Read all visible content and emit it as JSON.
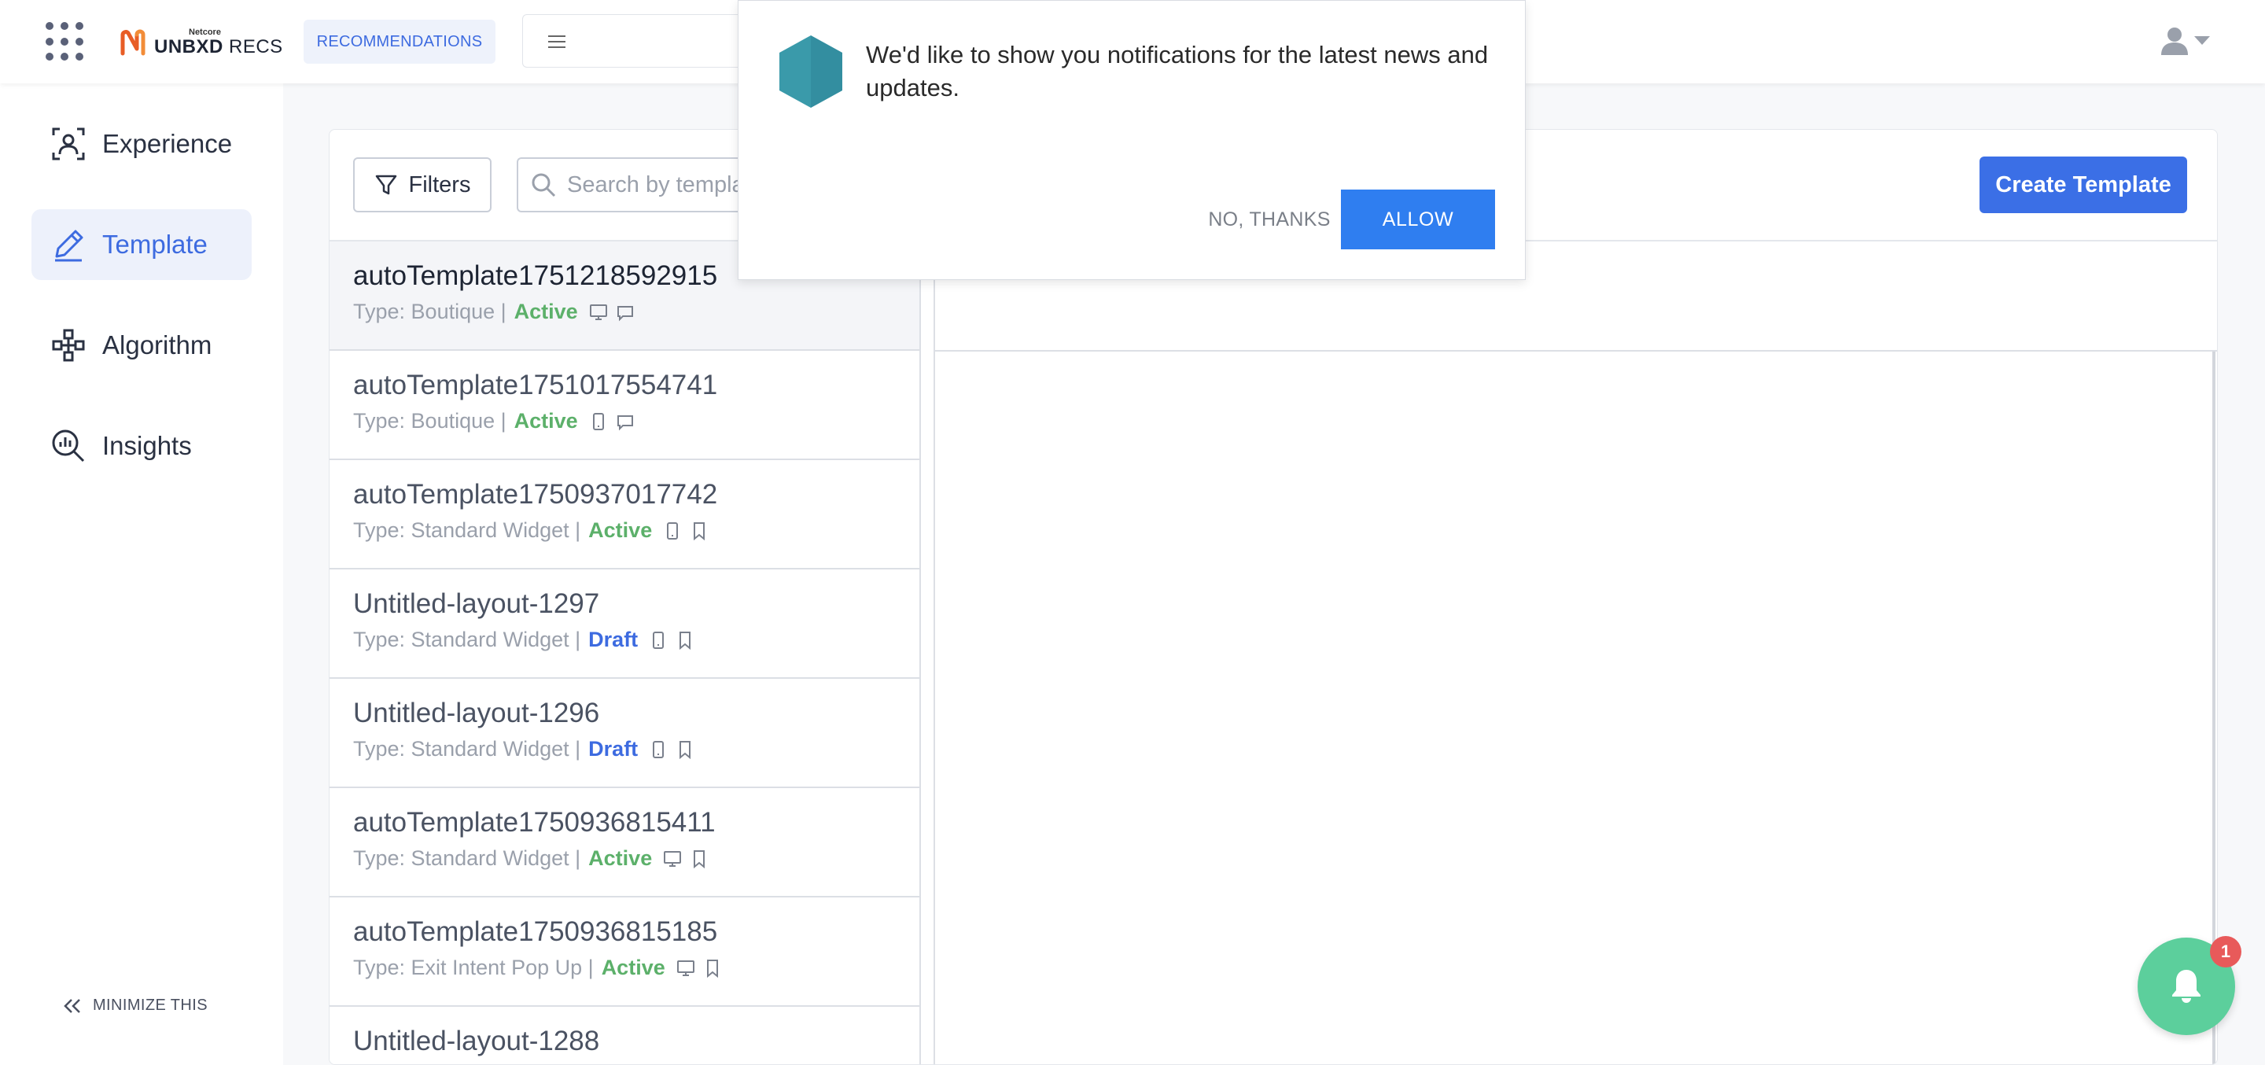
{
  "header": {
    "brand_small": "Netcore",
    "brand_bold": "UNBXD",
    "brand_rest": " RECS",
    "active_tab": "RECOMMENDATIONS"
  },
  "sidebar": {
    "items": [
      {
        "label": "Experience",
        "icon": "experience-icon",
        "active": false
      },
      {
        "label": "Template",
        "icon": "pencil-icon",
        "active": true
      },
      {
        "label": "Algorithm",
        "icon": "algorithm-icon",
        "active": false
      },
      {
        "label": "Insights",
        "icon": "insights-icon",
        "active": false
      }
    ],
    "minimize_label": "MINIMIZE THIS"
  },
  "toolbar": {
    "filters_label": "Filters",
    "search_placeholder": "Search by template name",
    "create_label": "Create Template"
  },
  "templates": [
    {
      "name": "autoTemplate1751218592915",
      "type": "Type: Boutique |",
      "status": "Active",
      "devices": [
        "desktop-icon",
        "mail-icon"
      ]
    },
    {
      "name": "autoTemplate1751017554741",
      "type": "Type: Boutique |",
      "status": "Active",
      "devices": [
        "mobile-icon",
        "mail-icon"
      ]
    },
    {
      "name": "autoTemplate1750937017742",
      "type": "Type: Standard Widget |",
      "status": "Active",
      "devices": [
        "mobile-icon",
        "bookmark-icon"
      ]
    },
    {
      "name": "Untitled-layout-1297",
      "type": "Type: Standard Widget |",
      "status": "Draft",
      "devices": [
        "mobile-icon",
        "bookmark-icon"
      ]
    },
    {
      "name": "Untitled-layout-1296",
      "type": "Type: Standard Widget |",
      "status": "Draft",
      "devices": [
        "mobile-icon",
        "bookmark-icon"
      ]
    },
    {
      "name": "autoTemplate1750936815411",
      "type": "Type: Standard Widget |",
      "status": "Active",
      "devices": [
        "desktop-icon",
        "bookmark-icon"
      ]
    },
    {
      "name": "autoTemplate1750936815185",
      "type": "Type: Exit Intent Pop Up |",
      "status": "Active",
      "devices": [
        "desktop-icon",
        "bookmark-icon"
      ]
    },
    {
      "name": "Untitled-layout-1288",
      "type": "",
      "status": "",
      "devices": []
    }
  ],
  "notification": {
    "message": "We'd like to show you notifications for the latest news and updates.",
    "decline_label": "NO, THANKS",
    "allow_label": "ALLOW"
  },
  "bell_badge": "1",
  "colors": {
    "accent": "#3b6fe6",
    "active_status": "#5cb06a",
    "draft_status": "#3d6be0",
    "bell": "#5ccf9c",
    "badge": "#e85a5a"
  }
}
